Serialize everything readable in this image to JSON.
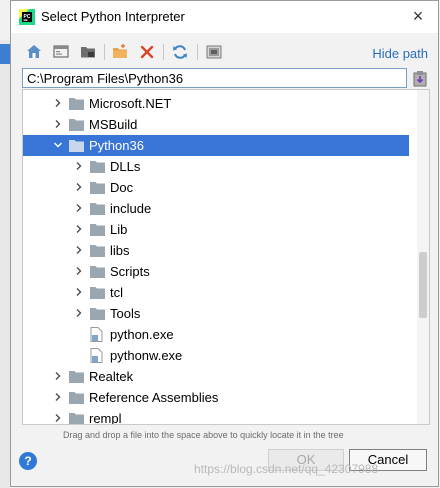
{
  "dialog": {
    "title": "Select Python Interpreter",
    "close_glyph": "×"
  },
  "toolbar": {
    "icons": [
      "home-icon",
      "desktop-icon",
      "project-icon",
      "new-folder-icon",
      "delete-icon",
      "refresh-icon",
      "show-hidden-icon"
    ],
    "hide_path_label": "Hide path"
  },
  "path": {
    "value": "C:\\Program Files\\Python36"
  },
  "tree": {
    "items": [
      {
        "label": "Microsoft.NET",
        "type": "folder",
        "expanded": false,
        "selected": false
      },
      {
        "label": "MSBuild",
        "type": "folder",
        "expanded": false,
        "selected": false
      },
      {
        "label": "Python36",
        "type": "folder",
        "expanded": true,
        "selected": true
      },
      {
        "label": "DLLs",
        "type": "folder",
        "expanded": false,
        "selected": false
      },
      {
        "label": "Doc",
        "type": "folder",
        "expanded": false,
        "selected": false
      },
      {
        "label": "include",
        "type": "folder",
        "expanded": false,
        "selected": false
      },
      {
        "label": "Lib",
        "type": "folder",
        "expanded": false,
        "selected": false
      },
      {
        "label": "libs",
        "type": "folder",
        "expanded": false,
        "selected": false
      },
      {
        "label": "Scripts",
        "type": "folder",
        "expanded": false,
        "selected": false
      },
      {
        "label": "tcl",
        "type": "folder",
        "expanded": false,
        "selected": false
      },
      {
        "label": "Tools",
        "type": "folder",
        "expanded": false,
        "selected": false
      },
      {
        "label": "python.exe",
        "type": "file",
        "expanded": false,
        "selected": false
      },
      {
        "label": "pythonw.exe",
        "type": "file",
        "expanded": false,
        "selected": false
      },
      {
        "label": "Realtek",
        "type": "folder",
        "expanded": false,
        "selected": false
      },
      {
        "label": "Reference Assemblies",
        "type": "folder",
        "expanded": false,
        "selected": false
      },
      {
        "label": "rempl",
        "type": "folder",
        "expanded": false,
        "selected": false
      }
    ]
  },
  "hint": "Drag and drop a file into the space above to quickly locate it in the tree",
  "buttons": {
    "help": "?",
    "ok": "OK",
    "cancel": "Cancel"
  },
  "watermark": "https://blog.csdn.net/qq_42307988",
  "colors": {
    "selection": "#3875d6",
    "link": "#2a6ebb",
    "folder": "#9aa7b0"
  }
}
